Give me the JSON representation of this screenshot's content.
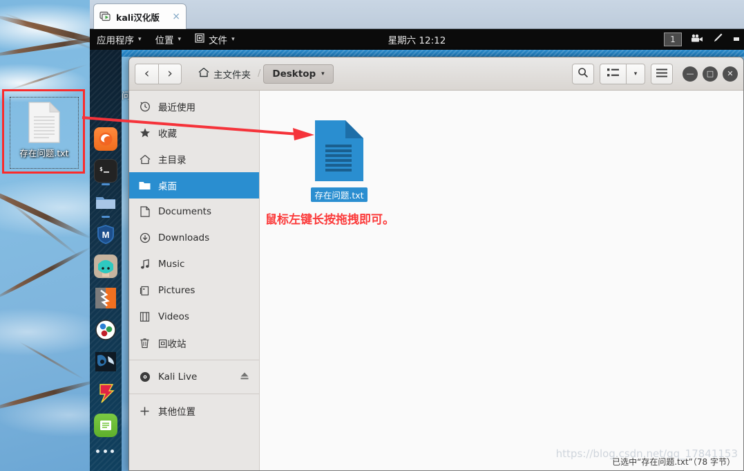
{
  "colors": {
    "accent_blue": "#2a8ed0",
    "annotation_red": "#fb3b3b",
    "panel_black": "#0b0b0b",
    "dock_dark": "#123249",
    "window_chrome": "#dad6d2"
  },
  "vm": {
    "tab_title": "kali汉化版",
    "tab_close_label": "×",
    "vm_icon_name": "virtual-machine-icon"
  },
  "panel": {
    "applications_label": "应用程序",
    "places_label": "位置",
    "files_label": "文件",
    "clock": "星期六 12:12",
    "workspace": "1",
    "caret": "▾",
    "icons": {
      "files_menu_icon": "files-menu-icon",
      "screencast_icon": "screencast-icon",
      "pen_icon": "pen-icon"
    }
  },
  "dock": {
    "apps": [
      {
        "name": "firefox",
        "label": "Firefox",
        "running": false
      },
      {
        "name": "terminal",
        "label": "Terminal",
        "running": true
      },
      {
        "name": "files",
        "label": "Files",
        "running": true
      },
      {
        "name": "metasploit",
        "label": "Metasploit",
        "running": false
      },
      {
        "name": "avatar-app",
        "label": "Avatar",
        "running": false
      },
      {
        "name": "zenmap",
        "label": "Zenmap",
        "running": false
      },
      {
        "name": "burpsuite",
        "label": "Burp Suite",
        "running": false
      },
      {
        "name": "wireshark",
        "label": "Wireshark",
        "running": false
      },
      {
        "name": "faraday",
        "label": "Faraday",
        "running": false
      },
      {
        "name": "text-editor",
        "label": "Text Editor",
        "running": false
      }
    ],
    "show_apps_label": "显示应用程序"
  },
  "file_manager": {
    "nav": {
      "back": "‹",
      "forward": "›"
    },
    "breadcrumb": {
      "home_label": "主文件夹",
      "separator": "/",
      "current_label": "Desktop",
      "current_caret": "▾"
    },
    "toolbar": {
      "search_icon": "search-icon",
      "view_list_icon": "view-list-icon",
      "view_caret": "▾",
      "menu_icon": "hamburger-menu-icon"
    },
    "window_buttons": {
      "minimize": "—",
      "maximize": "□",
      "close": "✕"
    },
    "sidebar": [
      {
        "label": "最近使用",
        "icon": "clock-icon",
        "active": false,
        "eject": false
      },
      {
        "label": "收藏",
        "icon": "star-icon",
        "active": false,
        "eject": false
      },
      {
        "label": "主目录",
        "icon": "home-icon",
        "active": false,
        "eject": false
      },
      {
        "label": "桌面",
        "icon": "folder-icon",
        "active": true,
        "eject": false
      },
      {
        "label": "Documents",
        "icon": "document-icon",
        "active": false,
        "eject": false
      },
      {
        "label": "Downloads",
        "icon": "download-icon",
        "active": false,
        "eject": false
      },
      {
        "label": "Music",
        "icon": "music-note-icon",
        "active": false,
        "eject": false
      },
      {
        "label": "Pictures",
        "icon": "picture-icon",
        "active": false,
        "eject": false
      },
      {
        "label": "Videos",
        "icon": "video-icon",
        "active": false,
        "eject": false
      },
      {
        "label": "回收站",
        "icon": "trash-icon",
        "active": false,
        "eject": false
      },
      {
        "label": "Kali Live",
        "icon": "disc-icon",
        "active": false,
        "eject": true
      },
      {
        "label": "其他位置",
        "icon": "plus-icon",
        "active": false,
        "eject": false
      }
    ],
    "files": [
      {
        "name": "存在问题.txt",
        "icon": "text-file-icon",
        "selected": true
      }
    ],
    "annotation": "鼠标左键长按拖拽即可。",
    "status": "已选中“存在问题.txt”（78 字节）",
    "watermark": "https://blog.csdn.net/qq_17841153"
  },
  "desktop": {
    "icon_label": "存在问题.txt",
    "icon_name": "text-file-icon",
    "partially_hidden_label": "存在问",
    "highlight_color": "#fb2b2b"
  }
}
